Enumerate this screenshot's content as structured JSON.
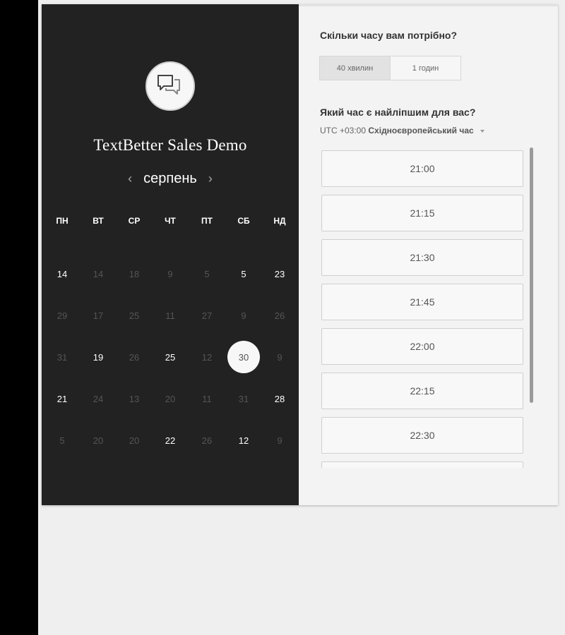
{
  "calendar": {
    "title": "TextBetter Sales Demo",
    "month": "серпень",
    "prev_arrow": "‹",
    "next_arrow": "›",
    "weekdays": [
      "ПН",
      "ВТ",
      "СР",
      "ЧТ",
      "ПТ",
      "СБ",
      "НД"
    ],
    "weeks": [
      [
        {
          "d": "14",
          "s": "on"
        },
        {
          "d": "14",
          "s": "off"
        },
        {
          "d": "18",
          "s": "off"
        },
        {
          "d": "9",
          "s": "off"
        },
        {
          "d": "5",
          "s": "off"
        },
        {
          "d": "5",
          "s": "on"
        },
        {
          "d": "23",
          "s": "on"
        }
      ],
      [
        {
          "d": "29",
          "s": "off"
        },
        {
          "d": "17",
          "s": "off"
        },
        {
          "d": "25",
          "s": "off"
        },
        {
          "d": "11",
          "s": "off"
        },
        {
          "d": "27",
          "s": "off"
        },
        {
          "d": "9",
          "s": "off"
        },
        {
          "d": "26",
          "s": "off"
        }
      ],
      [
        {
          "d": "31",
          "s": "off"
        },
        {
          "d": "19",
          "s": "on"
        },
        {
          "d": "26",
          "s": "off"
        },
        {
          "d": "25",
          "s": "on"
        },
        {
          "d": "12",
          "s": "off"
        },
        {
          "d": "30",
          "s": "selected"
        },
        {
          "d": "9",
          "s": "off"
        }
      ],
      [
        {
          "d": "21",
          "s": "on"
        },
        {
          "d": "24",
          "s": "off"
        },
        {
          "d": "13",
          "s": "off"
        },
        {
          "d": "20",
          "s": "off"
        },
        {
          "d": "11",
          "s": "off"
        },
        {
          "d": "31",
          "s": "off"
        },
        {
          "d": "28",
          "s": "on"
        }
      ],
      [
        {
          "d": "5",
          "s": "off"
        },
        {
          "d": "20",
          "s": "off"
        },
        {
          "d": "20",
          "s": "off"
        },
        {
          "d": "22",
          "s": "on"
        },
        {
          "d": "26",
          "s": "off"
        },
        {
          "d": "12",
          "s": "on"
        },
        {
          "d": "9",
          "s": "off"
        }
      ]
    ]
  },
  "booking": {
    "duration_question": "Скільки часу вам потрібно?",
    "durations": [
      {
        "label": "40 хвилин",
        "selected": true
      },
      {
        "label": "1 годин",
        "selected": false
      }
    ],
    "time_question": "Який час є найліпшим для вас?",
    "timezone_offset": "UTC +03:00",
    "timezone_name": "Східноєвропейський час",
    "slots": [
      "21:00",
      "21:15",
      "21:30",
      "21:45",
      "22:00",
      "22:15",
      "22:30",
      ""
    ]
  },
  "icons": {
    "avatar": "chat-bubbles-icon",
    "dropdown": "caret-down-icon"
  },
  "colors": {
    "left_panel": "#222222",
    "right_panel": "#f3f3f3",
    "disabled_day": "#555555"
  }
}
